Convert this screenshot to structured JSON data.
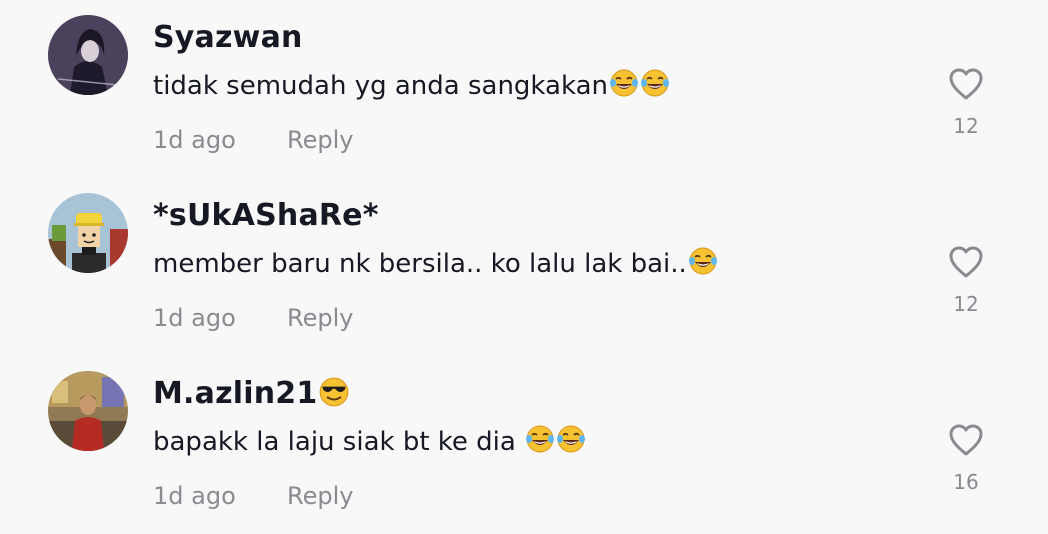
{
  "comments": [
    {
      "username": "Syazwan",
      "username_emoji": "",
      "text": "tidak semudah yg anda sangkakan",
      "text_emoji": [
        "face-with-tears-of-joy",
        "face-with-tears-of-joy"
      ],
      "time": "1d ago",
      "reply_label": "Reply",
      "likes": "12",
      "avatar_icon": "dark-anime-character-avatar"
    },
    {
      "username": "*sUkAShaRe*",
      "username_emoji": "",
      "text": "member baru nk bersila.. ko lalu lak bai..",
      "text_emoji": [
        "face-with-tears-of-joy"
      ],
      "time": "1d ago",
      "reply_label": "Reply",
      "likes": "12",
      "avatar_icon": "roblox-character-avatar"
    },
    {
      "username": "M.azlin21",
      "username_emoji": "smiling-face-with-sunglasses",
      "text": "bapakk la laju siak bt ke dia ",
      "text_emoji": [
        "face-with-tears-of-joy",
        "face-with-tears-of-joy"
      ],
      "time": "1d ago",
      "reply_label": "Reply",
      "likes": "16",
      "avatar_icon": "person-photo-avatar"
    }
  ],
  "colors": {
    "background": "#f8f8f8",
    "primary_text": "#161823",
    "secondary_text": "#8a8b91",
    "heart_outline": "#8a8b91"
  }
}
